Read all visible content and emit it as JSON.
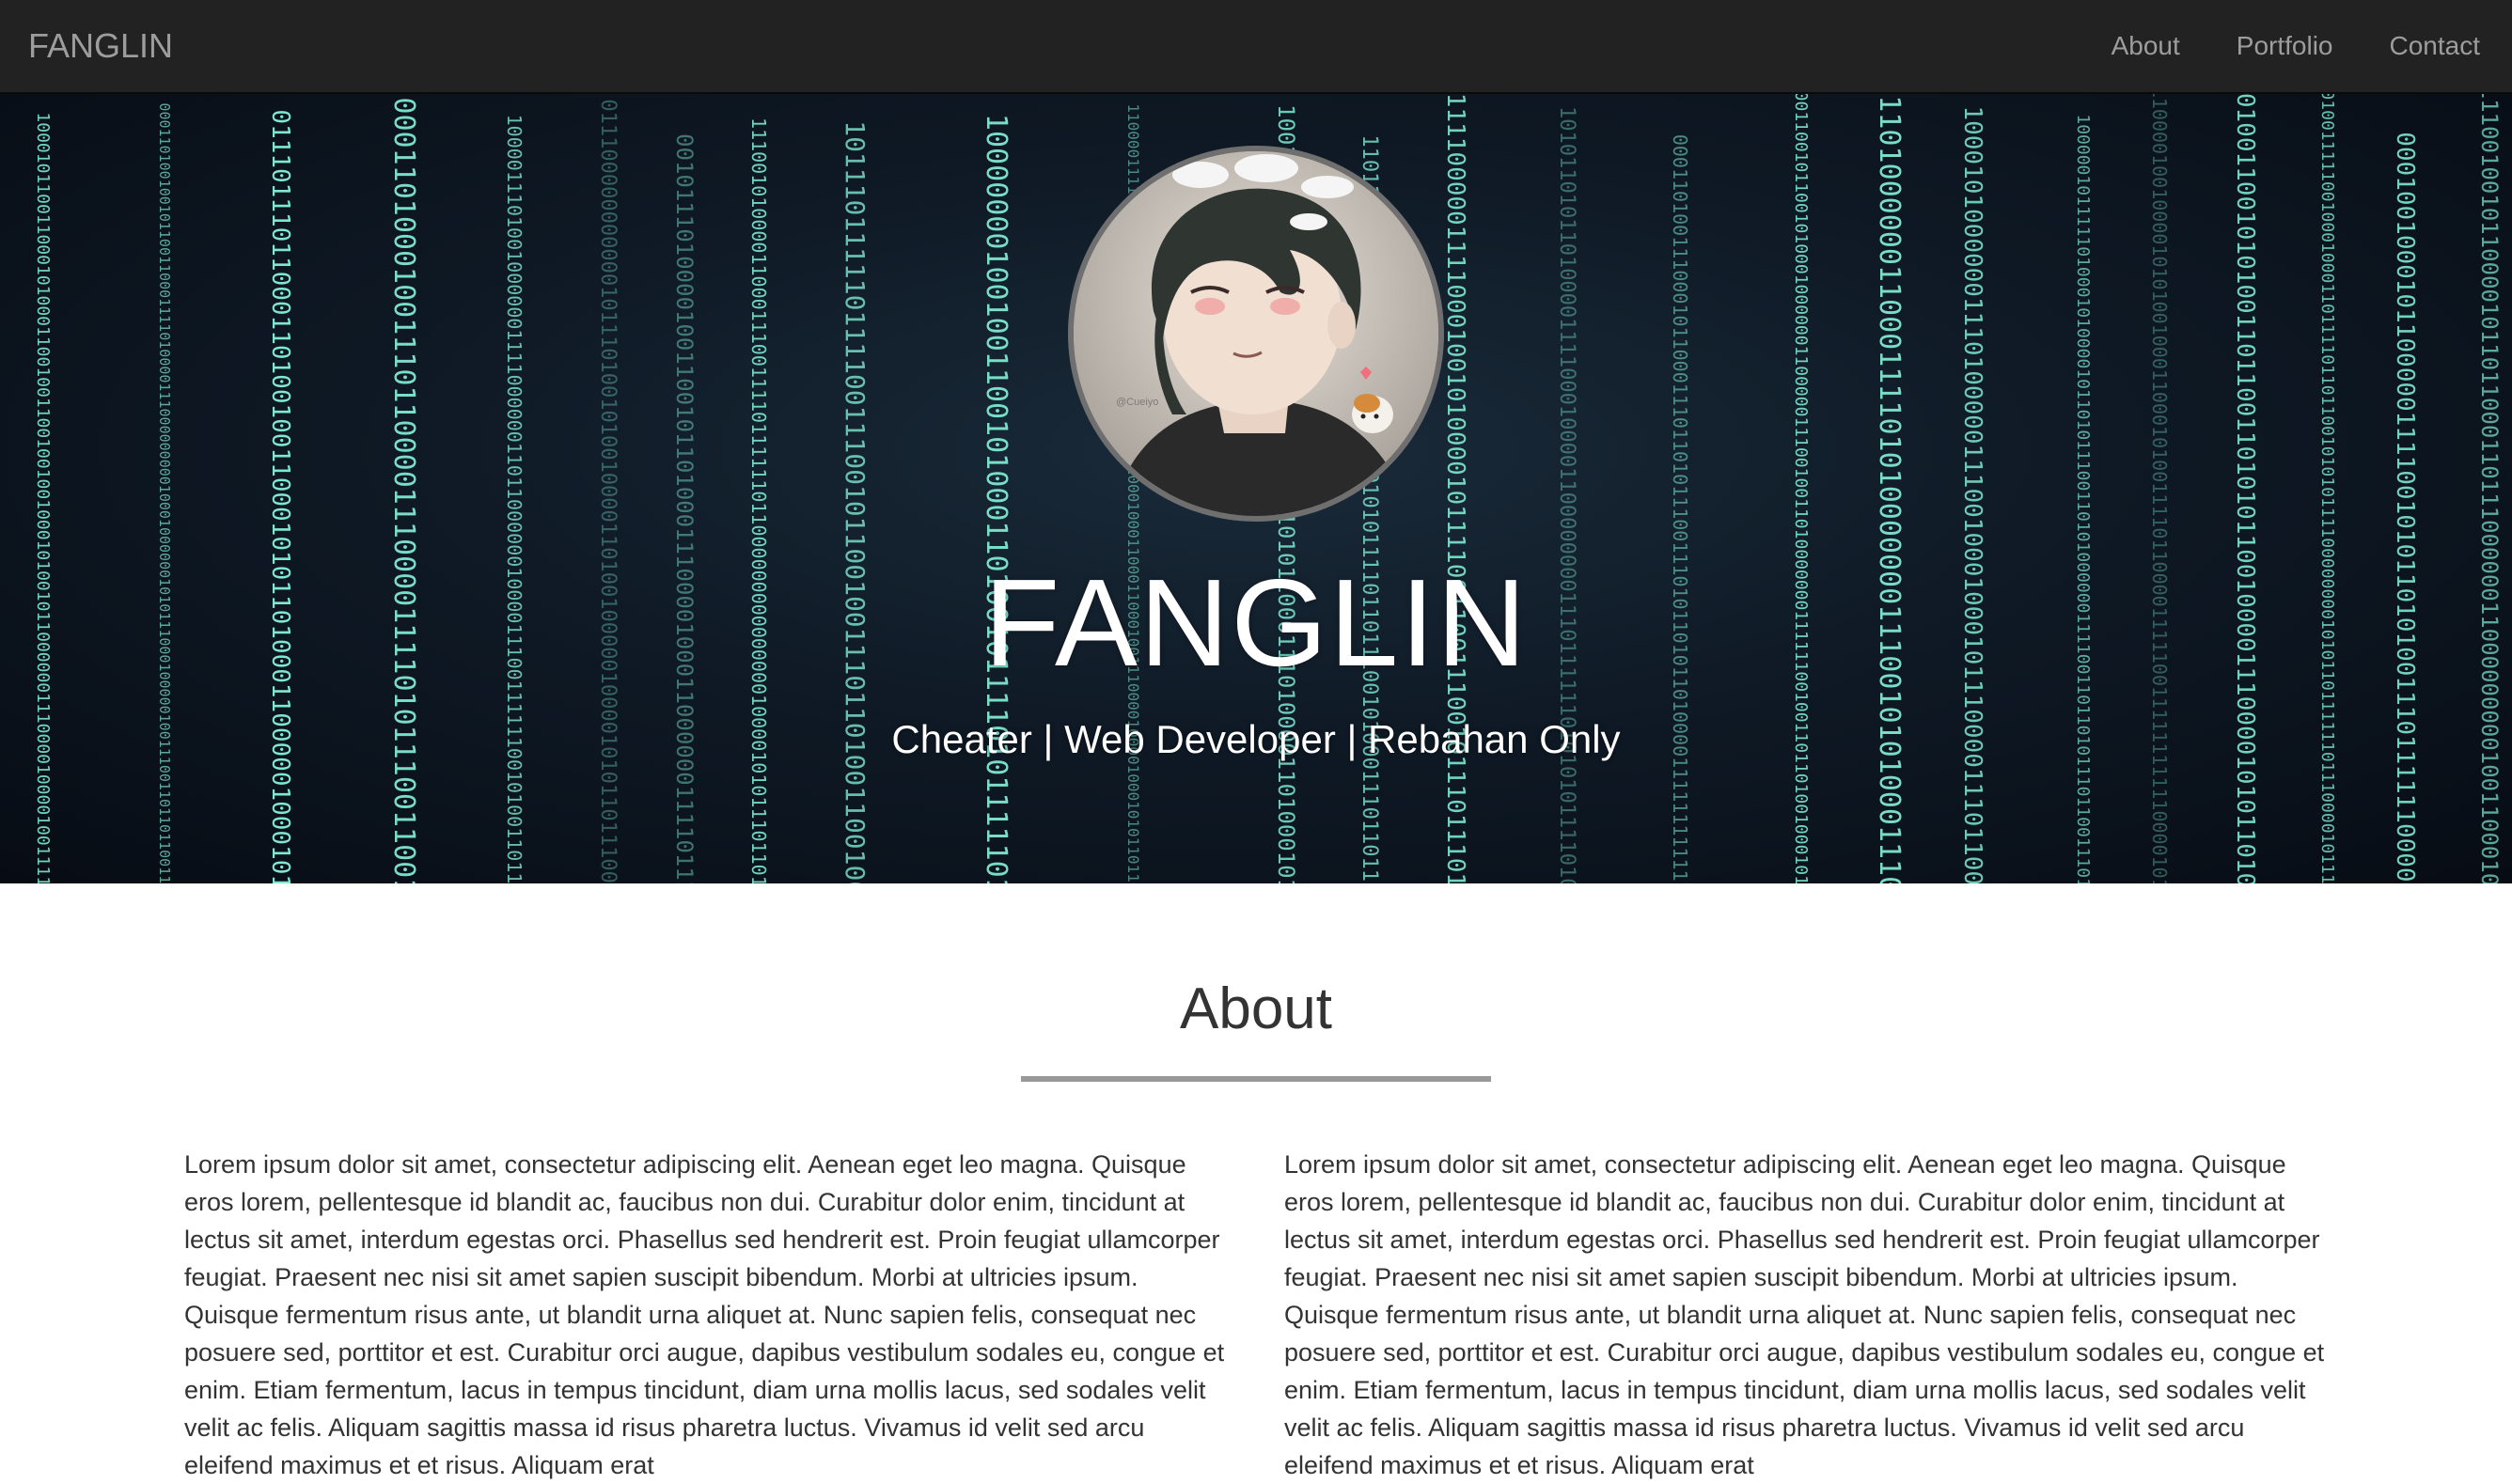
{
  "navbar": {
    "brand": "FANGLIN",
    "links": [
      {
        "label": "About"
      },
      {
        "label": "Portfolio"
      },
      {
        "label": "Contact"
      }
    ]
  },
  "hero": {
    "avatar_watermark": "@Cueiyo",
    "title": "FANGLIN",
    "subtitle": "Cheater | Web Developer | Rebahan Only"
  },
  "about": {
    "title": "About",
    "paragraphs": [
      "Lorem ipsum dolor sit amet, consectetur adipiscing elit. Aenean eget leo magna. Quisque eros lorem, pellentesque id blandit ac, faucibus non dui. Curabitur dolor enim, tincidunt at lectus sit amet, interdum egestas orci. Phasellus sed hendrerit est. Proin feugiat ullamcorper feugiat. Praesent nec nisi sit amet sapien suscipit bibendum. Morbi at ultricies ipsum. Quisque fermentum risus ante, ut blandit urna aliquet at. Nunc sapien felis, consequat nec posuere sed, porttitor et est. Curabitur orci augue, dapibus vestibulum sodales eu, congue et enim. Etiam fermentum, lacus in tempus tincidunt, diam urna mollis lacus, sed sodales velit velit ac felis. Aliquam sagittis massa id risus pharetra luctus. Vivamus id velit sed arcu eleifend maximus et et risus. Aliquam erat",
      "Lorem ipsum dolor sit amet, consectetur adipiscing elit. Aenean eget leo magna. Quisque eros lorem, pellentesque id blandit ac, faucibus non dui. Curabitur dolor enim, tincidunt at lectus sit amet, interdum egestas orci. Phasellus sed hendrerit est. Proin feugiat ullamcorper feugiat. Praesent nec nisi sit amet sapien suscipit bibendum. Morbi at ultricies ipsum. Quisque fermentum risus ante, ut blandit urna aliquet at. Nunc sapien felis, consequat nec posuere sed, porttitor et est. Curabitur orci augue, dapibus vestibulum sodales eu, congue et enim. Etiam fermentum, lacus in tempus tincidunt, diam urna mollis lacus, sed sodales velit velit ac felis. Aliquam sagittis massa id risus pharetra luctus. Vivamus id velit sed arcu eleifend maximus et et risus. Aliquam erat"
    ]
  },
  "colors": {
    "navbar_bg": "#222222",
    "nav_text": "#9d9d9d",
    "binary_rain": "#7fe8d0",
    "body_text": "#333333"
  }
}
